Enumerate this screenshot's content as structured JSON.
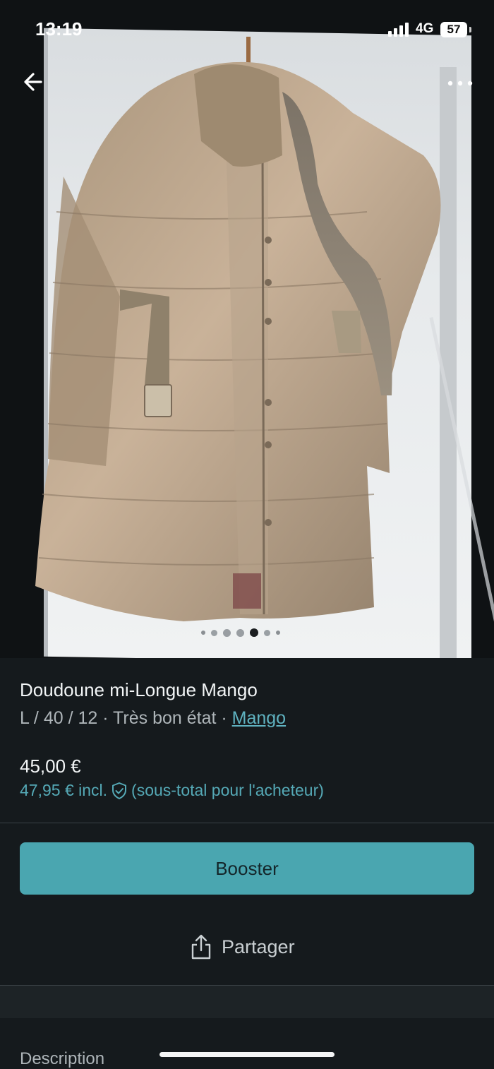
{
  "status_bar": {
    "time": "13:19",
    "network": "4G",
    "battery": "57"
  },
  "product": {
    "title": "Doudoune mi-Longue Mango",
    "size": "L / 40 / 12",
    "separator": " · ",
    "condition": "Très bon état",
    "brand": "Mango",
    "price": "45,00 €",
    "price_incl": "47,95 € incl.",
    "price_note": "(sous-total pour l'acheteur)"
  },
  "gallery": {
    "dot_count": 7,
    "active_index": 4
  },
  "actions": {
    "booster_label": "Booster",
    "share_label": "Partager"
  },
  "sections": {
    "description_label": "Description"
  },
  "colors": {
    "accent": "#4aa6b0",
    "link": "#5fb2c0",
    "background": "#151a1d"
  }
}
